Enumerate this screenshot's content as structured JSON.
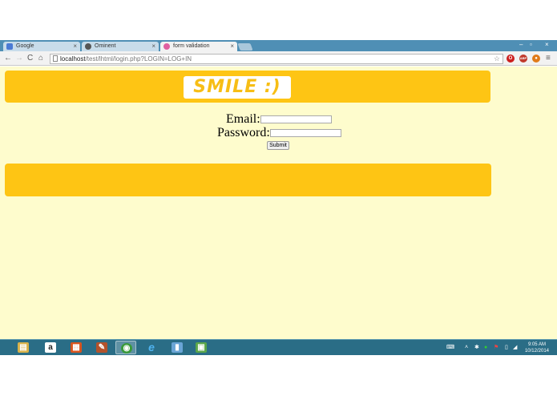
{
  "browser": {
    "tabs": [
      {
        "title": "Google",
        "color": "#4b7bd4"
      },
      {
        "title": "Ominent",
        "color": "#333333"
      },
      {
        "title": "form validation",
        "color": "#e05fa0"
      }
    ],
    "window_controls": {
      "minimize": "–",
      "maximize": "▫",
      "close": "×"
    },
    "url_host": "localhost",
    "url_path": "/test/lhtml/login.php?LOGIN=LOG+IN",
    "extensions": [
      {
        "name": "opera-icon",
        "label": "O",
        "color": "#cc1f1f"
      },
      {
        "name": "adblock-icon",
        "label": "ABP",
        "color": "#c0392b"
      },
      {
        "name": "extension-icon",
        "label": "●",
        "color": "#e07b1a"
      }
    ]
  },
  "page": {
    "logo_text": "SMILE   :)",
    "email_label": "Email:",
    "password_label": "Password:",
    "submit_label": "Submit",
    "background": "#fefccd",
    "banner_color": "#fec514"
  },
  "taskbar": {
    "apps": [
      {
        "name": "file-explorer-icon",
        "symbol": "▤",
        "color": "#d8b24a"
      },
      {
        "name": "amazon-icon",
        "symbol": "a",
        "color": "#222222"
      },
      {
        "name": "office-icon",
        "symbol": "▦",
        "color": "#d9541e"
      },
      {
        "name": "paint-icon",
        "symbol": "✎",
        "color": "#b3522b"
      },
      {
        "name": "chrome-icon",
        "symbol": "◉",
        "color": "#3a9a3a"
      },
      {
        "name": "internet-explorer-icon",
        "symbol": "e",
        "color": "#1e90d8"
      },
      {
        "name": "notepad-icon",
        "symbol": "▮",
        "color": "#6aa5d6"
      },
      {
        "name": "image-viewer-icon",
        "symbol": "▣",
        "color": "#5aa64a"
      }
    ],
    "time": "9:05 AM",
    "date": "10/12/2014"
  }
}
